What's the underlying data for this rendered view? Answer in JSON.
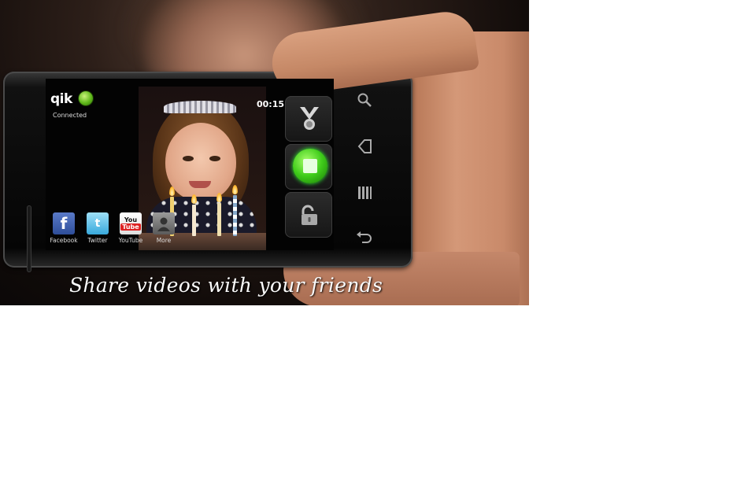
{
  "app": {
    "logo_text": "qik",
    "connection_status": "Connected",
    "recording_timer": "00:15"
  },
  "share_targets": [
    {
      "label": "Facebook",
      "icon": "facebook-icon",
      "glyph": "f"
    },
    {
      "label": "Twitter",
      "icon": "twitter-icon",
      "glyph": "t"
    },
    {
      "label": "YouTube",
      "icon": "youtube-icon",
      "glyph_top": "You",
      "glyph_bottom": "Tube"
    },
    {
      "label": "More",
      "icon": "contact-person-icon"
    }
  ],
  "controls": [
    {
      "icon": "qik-v-badge-icon"
    },
    {
      "icon": "record-stop-icon",
      "color": "#3fcc1a"
    },
    {
      "icon": "unlock-icon"
    }
  ],
  "hardware_keys": [
    "search-icon",
    "home-icon",
    "menu-icon",
    "back-icon"
  ],
  "caption": "Share videos with your friends",
  "colors": {
    "status_green": "#5fb81a",
    "record_green": "#3fcc1a"
  }
}
